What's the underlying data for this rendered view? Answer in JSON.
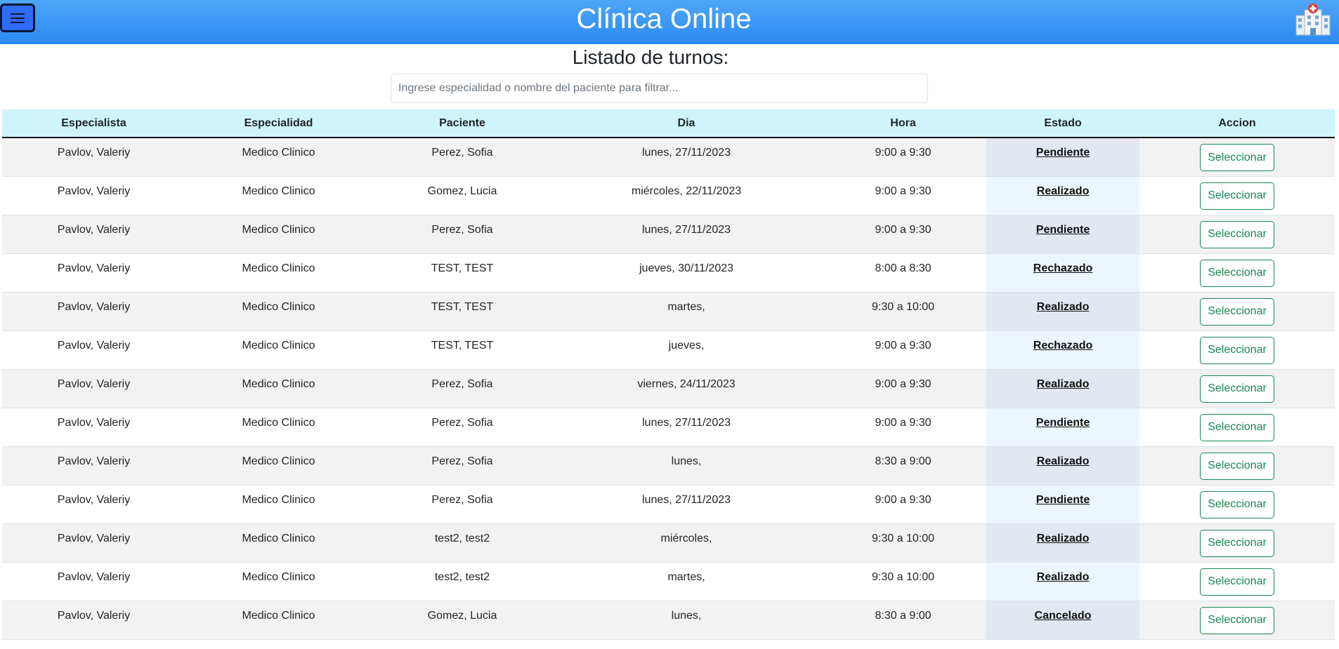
{
  "header": {
    "title": "Clínica Online",
    "menu_icon": "hamburger-menu-icon",
    "logo_icon": "hospital-icon",
    "brand_color": "#3b98f5"
  },
  "page": {
    "heading": "Listado de turnos:",
    "filter_placeholder": "Ingrese especialidad o nombre del paciente para filtrar..."
  },
  "table": {
    "columns": [
      "Especialista",
      "Especialidad",
      "Paciente",
      "Dia",
      "Hora",
      "Estado",
      "Accion"
    ],
    "rows": [
      {
        "especialista": "Pavlov, Valeriy",
        "especialidad": "Medico Clinico",
        "paciente": "Perez, Sofia",
        "dia": "lunes, 27/11/2023",
        "hora": "9:00 a 9:30",
        "estado": "Pendiente",
        "accion": "Seleccionar"
      },
      {
        "especialista": "Pavlov, Valeriy",
        "especialidad": "Medico Clinico",
        "paciente": "Gomez, Lucia",
        "dia": "miércoles, 22/11/2023",
        "hora": "9:00 a 9:30",
        "estado": "Realizado",
        "accion": "Seleccionar"
      },
      {
        "especialista": "Pavlov, Valeriy",
        "especialidad": "Medico Clinico",
        "paciente": "Perez, Sofia",
        "dia": "lunes, 27/11/2023",
        "hora": "9:00 a 9:30",
        "estado": "Pendiente",
        "accion": "Seleccionar"
      },
      {
        "especialista": "Pavlov, Valeriy",
        "especialidad": "Medico Clinico",
        "paciente": "TEST, TEST",
        "dia": "jueves, 30/11/2023",
        "hora": "8:00 a 8:30",
        "estado": "Rechazado",
        "accion": "Seleccionar"
      },
      {
        "especialista": "Pavlov, Valeriy",
        "especialidad": "Medico Clinico",
        "paciente": "TEST, TEST",
        "dia": "martes,",
        "hora": "9:30 a 10:00",
        "estado": "Realizado",
        "accion": "Seleccionar"
      },
      {
        "especialista": "Pavlov, Valeriy",
        "especialidad": "Medico Clinico",
        "paciente": "TEST, TEST",
        "dia": "jueves,",
        "hora": "9:00 a 9:30",
        "estado": "Rechazado",
        "accion": "Seleccionar"
      },
      {
        "especialista": "Pavlov, Valeriy",
        "especialidad": "Medico Clinico",
        "paciente": "Perez, Sofia",
        "dia": "viernes, 24/11/2023",
        "hora": "9:00 a 9:30",
        "estado": "Realizado",
        "accion": "Seleccionar"
      },
      {
        "especialista": "Pavlov, Valeriy",
        "especialidad": "Medico Clinico",
        "paciente": "Perez, Sofia",
        "dia": "lunes, 27/11/2023",
        "hora": "9:00 a 9:30",
        "estado": "Pendiente",
        "accion": "Seleccionar"
      },
      {
        "especialista": "Pavlov, Valeriy",
        "especialidad": "Medico Clinico",
        "paciente": "Perez, Sofia",
        "dia": "lunes,",
        "hora": "8:30 a 9:00",
        "estado": "Realizado",
        "accion": "Seleccionar"
      },
      {
        "especialista": "Pavlov, Valeriy",
        "especialidad": "Medico Clinico",
        "paciente": "Perez, Sofia",
        "dia": "lunes, 27/11/2023",
        "hora": "9:00 a 9:30",
        "estado": "Pendiente",
        "accion": "Seleccionar"
      },
      {
        "especialista": "Pavlov, Valeriy",
        "especialidad": "Medico Clinico",
        "paciente": "test2, test2",
        "dia": "miércoles,",
        "hora": "9:30 a 10:00",
        "estado": "Realizado",
        "accion": "Seleccionar"
      },
      {
        "especialista": "Pavlov, Valeriy",
        "especialidad": "Medico Clinico",
        "paciente": "test2, test2",
        "dia": "martes,",
        "hora": "9:30 a 10:00",
        "estado": "Realizado",
        "accion": "Seleccionar"
      },
      {
        "especialista": "Pavlov, Valeriy",
        "especialidad": "Medico Clinico",
        "paciente": "Gomez, Lucia",
        "dia": "lunes,",
        "hora": "8:30 a 9:00",
        "estado": "Cancelado",
        "accion": "Seleccionar"
      }
    ]
  },
  "colors": {
    "header_row": "#cff4fc",
    "action_button": "#198754"
  }
}
